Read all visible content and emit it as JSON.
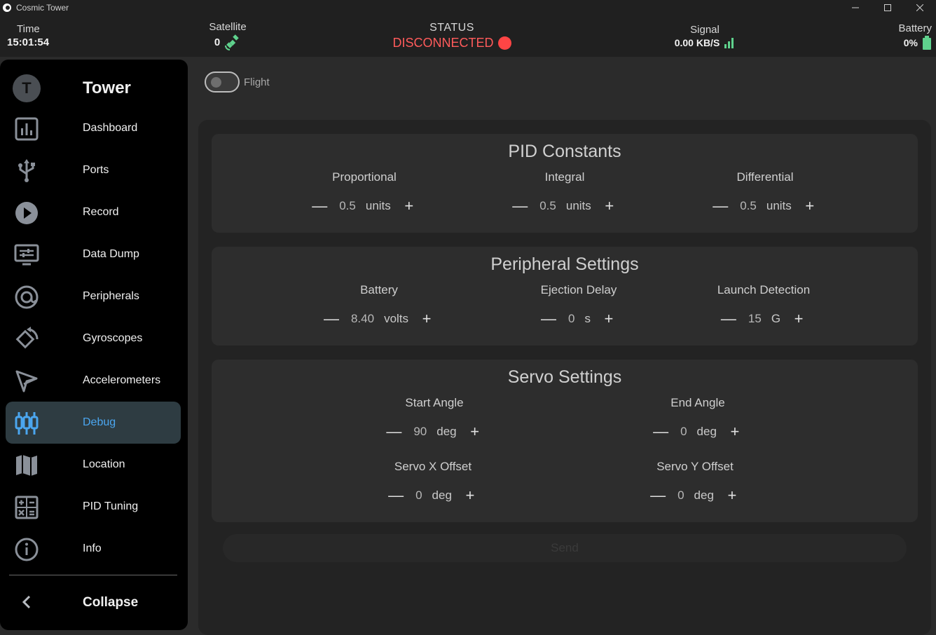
{
  "window": {
    "title": "Cosmic Tower"
  },
  "topbar": {
    "time": {
      "label": "Time",
      "value": "15:01:54"
    },
    "satellite": {
      "label": "Satellite",
      "value": "0"
    },
    "status": {
      "label": "STATUS",
      "value": "DISCONNECTED",
      "color": "#ff4545"
    },
    "signal": {
      "label": "Signal",
      "value": "0.00 KB/S",
      "color": "#5fd28d"
    },
    "battery": {
      "label": "Battery",
      "value": "0%",
      "color": "#5fd28d"
    }
  },
  "sidebar": {
    "avatar": "T",
    "title": "Tower",
    "items": [
      {
        "label": "Dashboard",
        "icon": "chart-icon"
      },
      {
        "label": "Ports",
        "icon": "usb-icon"
      },
      {
        "label": "Record",
        "icon": "play-icon"
      },
      {
        "label": "Data Dump",
        "icon": "monitor-icon"
      },
      {
        "label": "Peripherals",
        "icon": "at-icon"
      },
      {
        "label": "Gyroscopes",
        "icon": "rotate-icon"
      },
      {
        "label": "Accelerometers",
        "icon": "send-icon"
      },
      {
        "label": "Debug",
        "icon": "sliders-icon",
        "active": true
      },
      {
        "label": "Location",
        "icon": "map-icon"
      },
      {
        "label": "PID Tuning",
        "icon": "calculator-icon"
      },
      {
        "label": "Info",
        "icon": "info-icon"
      }
    ],
    "collapse": "Collapse",
    "accent": "#4ba6ef"
  },
  "flight_toggle": {
    "label": "Flight",
    "on": false
  },
  "pid": {
    "title": "PID Constants",
    "fields": [
      {
        "label": "Proportional",
        "value": "0.5",
        "unit": "units"
      },
      {
        "label": "Integral",
        "value": "0.5",
        "unit": "units"
      },
      {
        "label": "Differential",
        "value": "0.5",
        "unit": "units"
      }
    ]
  },
  "peripheral": {
    "title": "Peripheral Settings",
    "fields": [
      {
        "label": "Battery",
        "value": "8.40",
        "unit": "volts"
      },
      {
        "label": "Ejection Delay",
        "value": "0",
        "unit": "s"
      },
      {
        "label": "Launch Detection",
        "value": "15",
        "unit": "G"
      }
    ]
  },
  "servo": {
    "title": "Servo Settings",
    "fields": [
      {
        "label": "Start Angle",
        "value": "90",
        "unit": "deg"
      },
      {
        "label": "End Angle",
        "value": "0",
        "unit": "deg"
      },
      {
        "label": "Servo X Offset",
        "value": "0",
        "unit": "deg"
      },
      {
        "label": "Servo Y Offset",
        "value": "0",
        "unit": "deg"
      }
    ]
  },
  "stepper_labels": {
    "minus": "—",
    "plus": "+"
  },
  "send_label": "Send"
}
